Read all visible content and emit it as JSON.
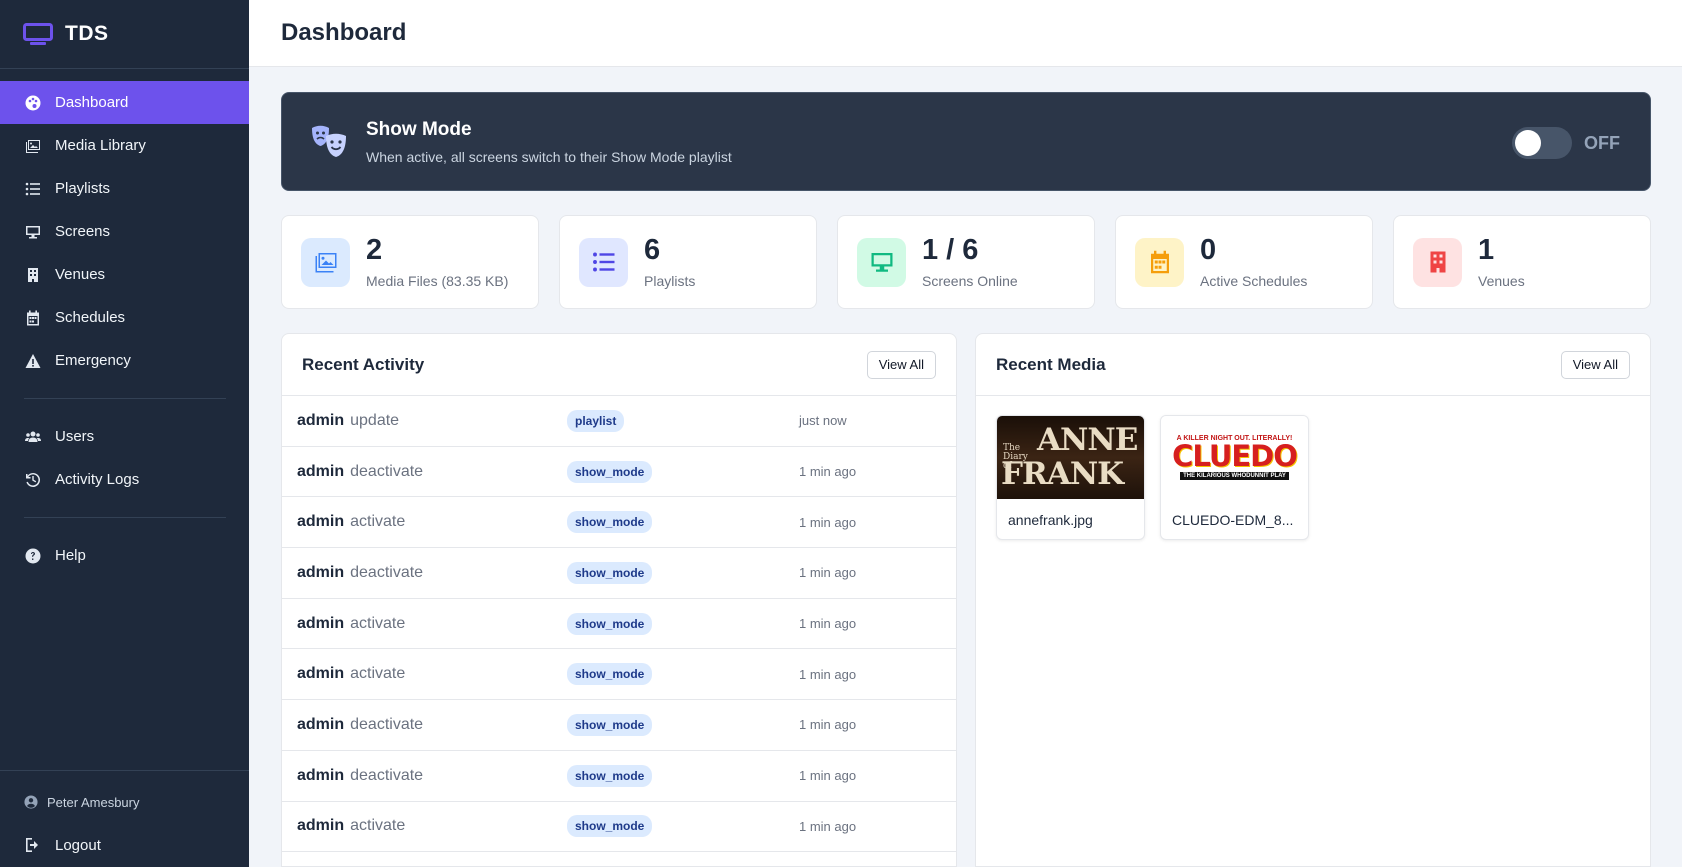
{
  "app": {
    "name": "TDS"
  },
  "sidebar": {
    "items": [
      {
        "label": "Dashboard",
        "icon": "palette-icon",
        "active": true
      },
      {
        "label": "Media Library",
        "icon": "images-icon"
      },
      {
        "label": "Playlists",
        "icon": "list-icon"
      },
      {
        "label": "Screens",
        "icon": "desktop-icon"
      },
      {
        "label": "Venues",
        "icon": "building-icon"
      },
      {
        "label": "Schedules",
        "icon": "calendar-icon"
      },
      {
        "label": "Emergency",
        "icon": "warning-icon"
      }
    ],
    "admin_items": [
      {
        "label": "Users",
        "icon": "users-icon"
      },
      {
        "label": "Activity Logs",
        "icon": "history-icon"
      }
    ],
    "help": {
      "label": "Help",
      "icon": "question-icon"
    },
    "user": "Peter Amesbury",
    "logout": "Logout"
  },
  "header": {
    "title": "Dashboard"
  },
  "show_mode": {
    "title": "Show Mode",
    "description": "When active, all screens switch to their Show Mode playlist",
    "state": "OFF"
  },
  "stats": [
    {
      "value": "2",
      "label": "Media Files (83.35 KB)",
      "icon": "images-icon",
      "bg": "#dbeafe",
      "fg": "#3b82f6"
    },
    {
      "value": "6",
      "label": "Playlists",
      "icon": "list-icon",
      "bg": "#e0e7ff",
      "fg": "#4f46e5"
    },
    {
      "value": "1 / 6",
      "label": "Screens Online",
      "icon": "desktop-icon",
      "bg": "#d1fae5",
      "fg": "#10b981"
    },
    {
      "value": "0",
      "label": "Active Schedules",
      "icon": "calendar-icon",
      "bg": "#fef3c7",
      "fg": "#f59e0b"
    },
    {
      "value": "1",
      "label": "Venues",
      "icon": "building-icon",
      "bg": "#fee2e2",
      "fg": "#ef4444"
    }
  ],
  "recent_activity": {
    "title": "Recent Activity",
    "view_all": "View All",
    "rows": [
      {
        "user": "admin",
        "action": "update",
        "type": "playlist",
        "time": "just now"
      },
      {
        "user": "admin",
        "action": "deactivate",
        "type": "show_mode",
        "time": "1 min ago"
      },
      {
        "user": "admin",
        "action": "activate",
        "type": "show_mode",
        "time": "1 min ago"
      },
      {
        "user": "admin",
        "action": "deactivate",
        "type": "show_mode",
        "time": "1 min ago"
      },
      {
        "user": "admin",
        "action": "activate",
        "type": "show_mode",
        "time": "1 min ago"
      },
      {
        "user": "admin",
        "action": "activate",
        "type": "show_mode",
        "time": "1 min ago"
      },
      {
        "user": "admin",
        "action": "deactivate",
        "type": "show_mode",
        "time": "1 min ago"
      },
      {
        "user": "admin",
        "action": "deactivate",
        "type": "show_mode",
        "time": "1 min ago"
      },
      {
        "user": "admin",
        "action": "activate",
        "type": "show_mode",
        "time": "1 min ago"
      }
    ]
  },
  "recent_media": {
    "title": "Recent Media",
    "view_all": "View All",
    "items": [
      {
        "name": "annefrank.jpg",
        "thumb_lines": [
          "The",
          "Diary",
          "of",
          "ANNE",
          "FRANK"
        ]
      },
      {
        "name": "CLUEDO-EDM_8...",
        "thumb_lines": [
          "A KILLER NIGHT OUT. LITERALLY!",
          "CLUEDO",
          "THE KILARIOUS WHODUNNIT PLAY"
        ]
      }
    ]
  }
}
